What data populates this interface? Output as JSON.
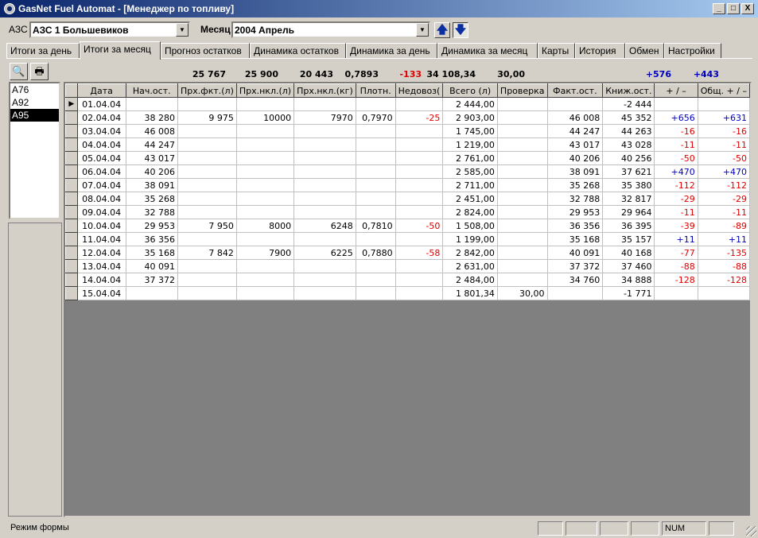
{
  "window": {
    "title": "GasNet Fuel Automat - [Менеджер по топливу]",
    "buttons": [
      "_",
      "□",
      "X"
    ]
  },
  "top_bar": {
    "azs_label": "АЗС",
    "azs_value": "АЗС 1 Большевиков",
    "month_label": "Месяц",
    "month_value": "2004 Апрель"
  },
  "tabs": [
    {
      "label": "Итоги за день"
    },
    {
      "label": "Итоги за месяц"
    },
    {
      "label": "Прогноз остатков"
    },
    {
      "label": "Динамика остатков"
    },
    {
      "label": "Динамика за день"
    },
    {
      "label": "Динамика за месяц"
    },
    {
      "label": "Карты"
    },
    {
      "label": "История"
    },
    {
      "label": "Обмен"
    },
    {
      "label": "Настройки"
    }
  ],
  "active_tab": "Итоги за месяц",
  "totals": {
    "prh_fakt": "25 767",
    "prh_nkl_l": "25 900",
    "prh_nkl_kg": "20 443",
    "plotn": "0,7893",
    "nedovoz": "-133",
    "vsego": "34 108,34",
    "proverka": "30,00",
    "pm": "+576",
    "obsh_pm": "+443"
  },
  "fuel_list": [
    "А76",
    "А92",
    "А95"
  ],
  "fuel_selected": "А95",
  "grid": {
    "columns": [
      "Дата",
      "Нач.ост.",
      "Прх.фкт.(л)",
      "Прх.нкл.(л)",
      "Прх.нкл.(кг)",
      "Плотн.",
      "Недовоз(",
      "Всего (л)",
      "Проверка",
      "Факт.ост.",
      "Книж.ост.",
      "+ / –",
      "Общ. + / –"
    ],
    "rows": [
      [
        "01.04.04",
        "",
        "",
        "",
        "",
        "",
        "",
        "2 444,00",
        "",
        "",
        "-2 444",
        "",
        ""
      ],
      [
        "02.04.04",
        "38 280",
        "9 975",
        "10000",
        "7970",
        "0,7970",
        "-25",
        "2 903,00",
        "",
        "46 008",
        "45 352",
        "+656",
        "+631"
      ],
      [
        "03.04.04",
        "46 008",
        "",
        "",
        "",
        "",
        "",
        "1 745,00",
        "",
        "44 247",
        "44 263",
        "-16",
        "-16"
      ],
      [
        "04.04.04",
        "44 247",
        "",
        "",
        "",
        "",
        "",
        "1 219,00",
        "",
        "43 017",
        "43 028",
        "-11",
        "-11"
      ],
      [
        "05.04.04",
        "43 017",
        "",
        "",
        "",
        "",
        "",
        "2 761,00",
        "",
        "40 206",
        "40 256",
        "-50",
        "-50"
      ],
      [
        "06.04.04",
        "40 206",
        "",
        "",
        "",
        "",
        "",
        "2 585,00",
        "",
        "38 091",
        "37 621",
        "+470",
        "+470"
      ],
      [
        "07.04.04",
        "38 091",
        "",
        "",
        "",
        "",
        "",
        "2 711,00",
        "",
        "35 268",
        "35 380",
        "-112",
        "-112"
      ],
      [
        "08.04.04",
        "35 268",
        "",
        "",
        "",
        "",
        "",
        "2 451,00",
        "",
        "32 788",
        "32 817",
        "-29",
        "-29"
      ],
      [
        "09.04.04",
        "32 788",
        "",
        "",
        "",
        "",
        "",
        "2 824,00",
        "",
        "29 953",
        "29 964",
        "-11",
        "-11"
      ],
      [
        "10.04.04",
        "29 953",
        "7 950",
        "8000",
        "6248",
        "0,7810",
        "-50",
        "1 508,00",
        "",
        "36 356",
        "36 395",
        "-39",
        "-89"
      ],
      [
        "11.04.04",
        "36 356",
        "",
        "",
        "",
        "",
        "",
        "1 199,00",
        "",
        "35 168",
        "35 157",
        "+11",
        "+11"
      ],
      [
        "12.04.04",
        "35 168",
        "7 842",
        "7900",
        "6225",
        "0,7880",
        "-58",
        "2 842,00",
        "",
        "40 091",
        "40 168",
        "-77",
        "-135"
      ],
      [
        "13.04.04",
        "40 091",
        "",
        "",
        "",
        "",
        "",
        "2 631,00",
        "",
        "37 372",
        "37 460",
        "-88",
        "-88"
      ],
      [
        "14.04.04",
        "37 372",
        "",
        "",
        "",
        "",
        "",
        "2 484,00",
        "",
        "34 760",
        "34 888",
        "-128",
        "-128"
      ],
      [
        "15.04.04",
        "",
        "",
        "",
        "",
        "",
        "",
        "1 801,34",
        "30,00",
        "",
        "-1 771",
        "",
        ""
      ]
    ],
    "current_row_marker": "▶"
  },
  "statusbar": {
    "mode": "Режим формы",
    "num": "NUM"
  },
  "icons": {
    "preview": "print-preview-icon",
    "print": "printer-icon",
    "up": "arrow-up-icon",
    "down": "arrow-down-icon"
  },
  "colors": {
    "title_bar": "#0a246a",
    "negative": "#e00000",
    "positive": "#0000c0",
    "face": "#d4d0c8"
  }
}
